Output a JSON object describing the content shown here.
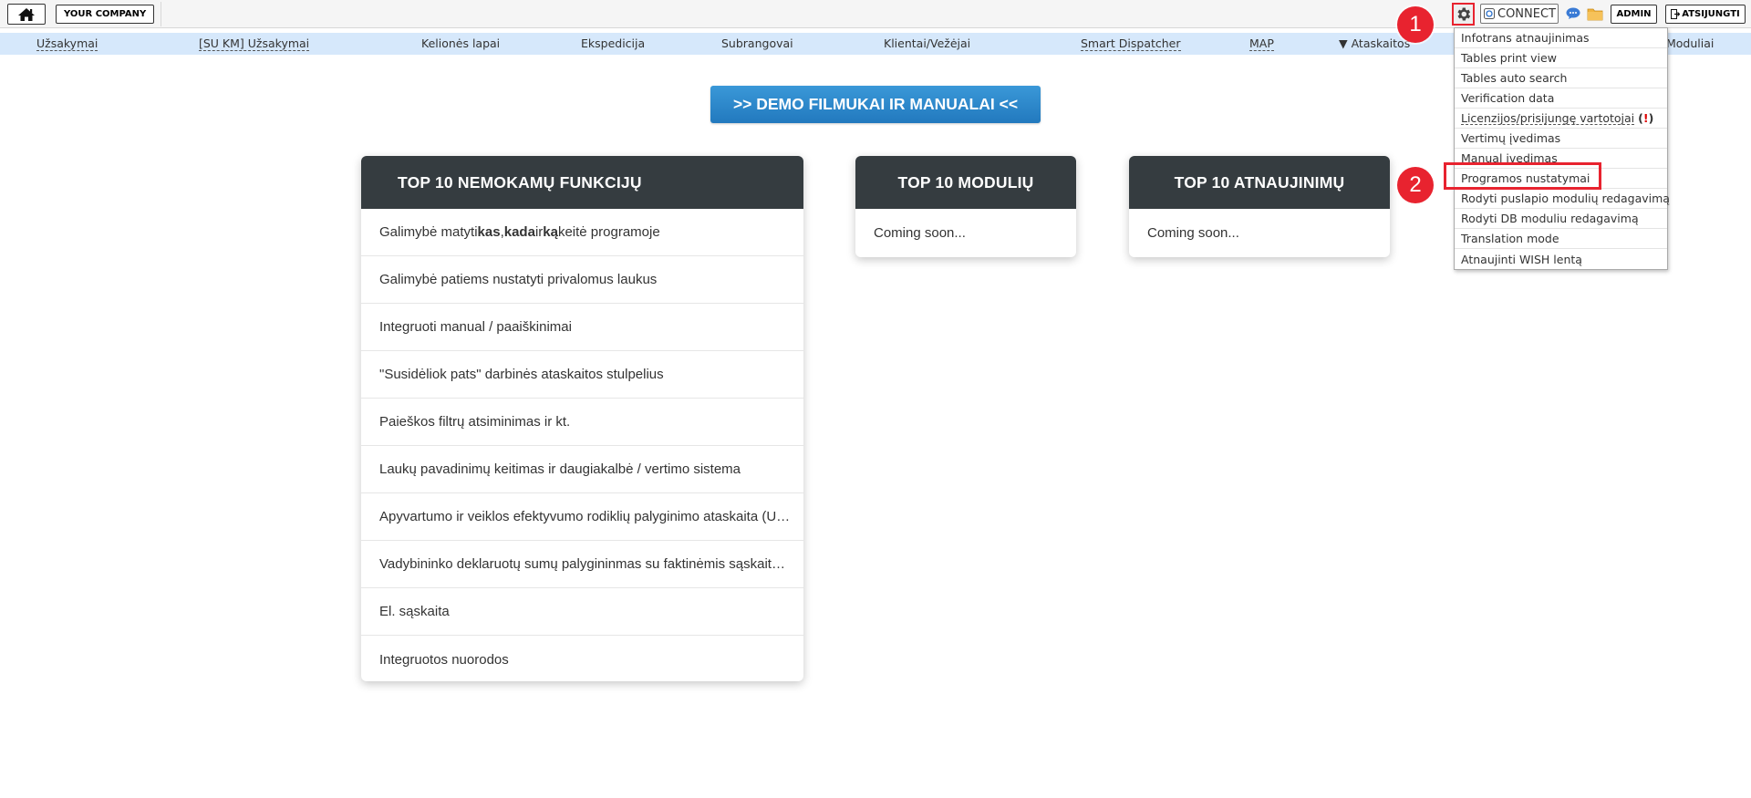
{
  "topbar": {
    "home_icon": "home-icon",
    "company": "YOUR COMPANY",
    "connect": "CONNECT",
    "admin": "ADMIN",
    "logout": "ATSIJUNGTI"
  },
  "nav": {
    "items": [
      "Užsakymai",
      "[SU KM] Užsakymai",
      "Kelionės lapai",
      "Ekspedicija",
      "Subrangovai",
      "Klientai/Vežėjai",
      "Smart Dispatcher",
      "MAP",
      "▼ Ataskaitos",
      "Moduliai"
    ]
  },
  "demo_button": ">> DEMO FILMUKAI IR MANUALAI <<",
  "cards": {
    "functions": {
      "title": "TOP 10 NEMOKAMŲ FUNKCIJŲ",
      "row1_pre": "Galimybė matyti ",
      "row1_kas": "kas",
      "row1_comma": ", ",
      "row1_kada": "kada",
      "row1_ir": " ir ",
      "row1_ka": "ką",
      "row1_post": " keitė programoje",
      "rows": [
        "Galimybė patiems nustatyti privalomus laukus",
        "Integruoti manual / paaiškinimai",
        "\"Susidėliok pats\" darbinės ataskaitos stulpelius",
        "Paieškos filtrų atsiminimas ir kt.",
        "Laukų pavadinimų keitimas ir daugiakalbė / vertimo sistema",
        "Apyvartumo ir veiklos efektyvumo rodiklių palyginimo ataskaita (U…",
        "Vadybininko deklaruotų sumų palygininmas su faktinėmis sąskait…",
        "El. sąskaita",
        "Integruotos nuorodos"
      ]
    },
    "modules": {
      "title": "TOP 10 MODULIŲ",
      "body": "Coming soon..."
    },
    "updates": {
      "title": "TOP 10 ATNAUJINIMŲ",
      "body": "Coming soon..."
    }
  },
  "dropdown": {
    "items": [
      "Infotrans atnaujinimas",
      "Tables print view",
      "Tables auto search",
      "Verification data",
      "Licenzijos/prisijungę vartotojai",
      "Vertimų įvedimas",
      "Manual įvedimas",
      "Programos nustatymai",
      "Rodyti puslapio modulių redagavimą",
      "Rodyti DB moduliu redagavimą",
      "Translation mode",
      "Atnaujinti WISH lentą"
    ],
    "warn_open": "(",
    "warn_mark": "!",
    "warn_close": ")"
  },
  "badges": {
    "one": "1",
    "two": "2"
  },
  "colors": {
    "accent_red": "#e8232f",
    "nav_bg": "#d6e8fb",
    "demo_blue": "#2a86c9",
    "card_head": "#353c40"
  }
}
